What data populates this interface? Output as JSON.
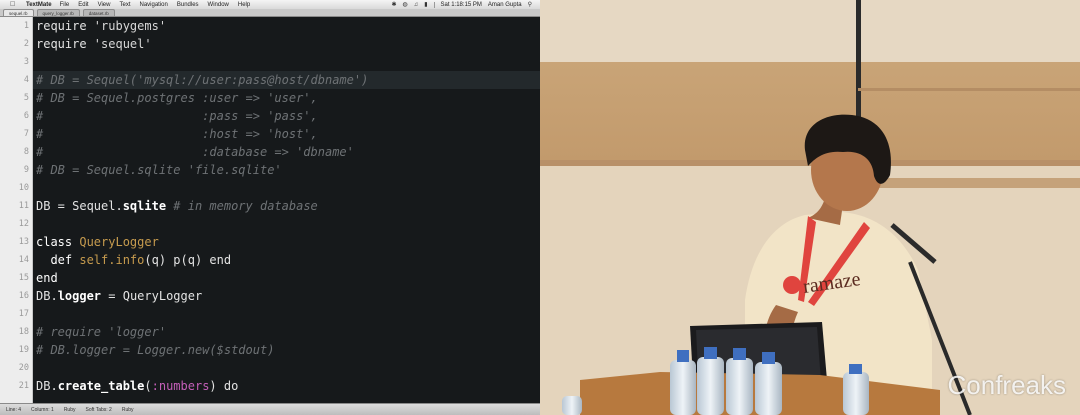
{
  "menubar": {
    "app": "TextMate",
    "items": [
      "File",
      "Edit",
      "View",
      "Text",
      "Navigation",
      "Bundles",
      "Window",
      "Help"
    ],
    "clock": "Sat 1:18:15 PM",
    "user": "Aman Gupta"
  },
  "tabs": [
    "sequel.rb",
    "query_logger.rb",
    "dataset.rb"
  ],
  "editor": {
    "lines": [
      {
        "n": "1",
        "segs": [
          {
            "t": "require ",
            "c": "t-norm"
          },
          {
            "t": "'rubygems'",
            "c": "t-str"
          }
        ]
      },
      {
        "n": "2",
        "segs": [
          {
            "t": "require ",
            "c": "t-norm"
          },
          {
            "t": "'sequel'",
            "c": "t-str"
          }
        ]
      },
      {
        "n": "3",
        "segs": []
      },
      {
        "n": "4",
        "segs": [
          {
            "t": "# DB = Sequel('mysql://user:pass@host/dbname')",
            "c": "t-com"
          }
        ],
        "highlight": true
      },
      {
        "n": "5",
        "segs": [
          {
            "t": "# DB = Sequel.postgres :user => 'user',",
            "c": "t-com"
          }
        ]
      },
      {
        "n": "6",
        "segs": [
          {
            "t": "#                      :pass => 'pass',",
            "c": "t-com"
          }
        ]
      },
      {
        "n": "7",
        "segs": [
          {
            "t": "#                      :host => 'host',",
            "c": "t-com"
          }
        ]
      },
      {
        "n": "8",
        "segs": [
          {
            "t": "#                      :database => 'dbname'",
            "c": "t-com"
          }
        ]
      },
      {
        "n": "9",
        "segs": [
          {
            "t": "# DB = Sequel.sqlite 'file.sqlite'",
            "c": "t-com"
          }
        ]
      },
      {
        "n": "10",
        "segs": []
      },
      {
        "n": "11",
        "segs": [
          {
            "t": "DB = Sequel.",
            "c": "t-norm"
          },
          {
            "t": "sqlite",
            "c": "t-bold"
          },
          {
            "t": " # in memory database",
            "c": "t-com"
          }
        ]
      },
      {
        "n": "12",
        "segs": []
      },
      {
        "n": "13",
        "segs": [
          {
            "t": "class ",
            "c": "t-kw"
          },
          {
            "t": "QueryLogger",
            "c": "t-cls"
          }
        ]
      },
      {
        "n": "14",
        "segs": [
          {
            "t": "  def ",
            "c": "t-kw"
          },
          {
            "t": "self.info",
            "c": "t-cls"
          },
          {
            "t": "(q) p(q) end",
            "c": "t-norm"
          }
        ]
      },
      {
        "n": "15",
        "segs": [
          {
            "t": "end",
            "c": "t-kw"
          }
        ]
      },
      {
        "n": "16",
        "segs": [
          {
            "t": "DB.",
            "c": "t-norm"
          },
          {
            "t": "logger",
            "c": "t-bold"
          },
          {
            "t": " = QueryLogger",
            "c": "t-norm"
          }
        ]
      },
      {
        "n": "17",
        "segs": []
      },
      {
        "n": "18",
        "segs": [
          {
            "t": "# require 'logger'",
            "c": "t-com"
          }
        ]
      },
      {
        "n": "19",
        "segs": [
          {
            "t": "# DB.logger = Logger.new($stdout)",
            "c": "t-com"
          }
        ]
      },
      {
        "n": "20",
        "segs": []
      },
      {
        "n": "21",
        "segs": [
          {
            "t": "DB.",
            "c": "t-norm"
          },
          {
            "t": "create_table",
            "c": "t-bold"
          },
          {
            "t": "(",
            "c": "t-norm"
          },
          {
            "t": ":numbers",
            "c": "t-sym"
          },
          {
            "t": ") do",
            "c": "t-norm"
          }
        ]
      }
    ]
  },
  "statusbar": {
    "line": "Line: 4",
    "column": "Column: 1",
    "language": "Ruby",
    "tabsize": "Soft Tabs: 2",
    "symbol": "Ruby"
  },
  "stage": {
    "shirt_text": "ramaze",
    "watermark": "Confreaks"
  },
  "colors": {
    "editor_bg": "#16191b",
    "comment": "#6e7275",
    "class": "#c69b4e",
    "symbol": "#c45fb8",
    "lanyard": "#e0443e"
  }
}
